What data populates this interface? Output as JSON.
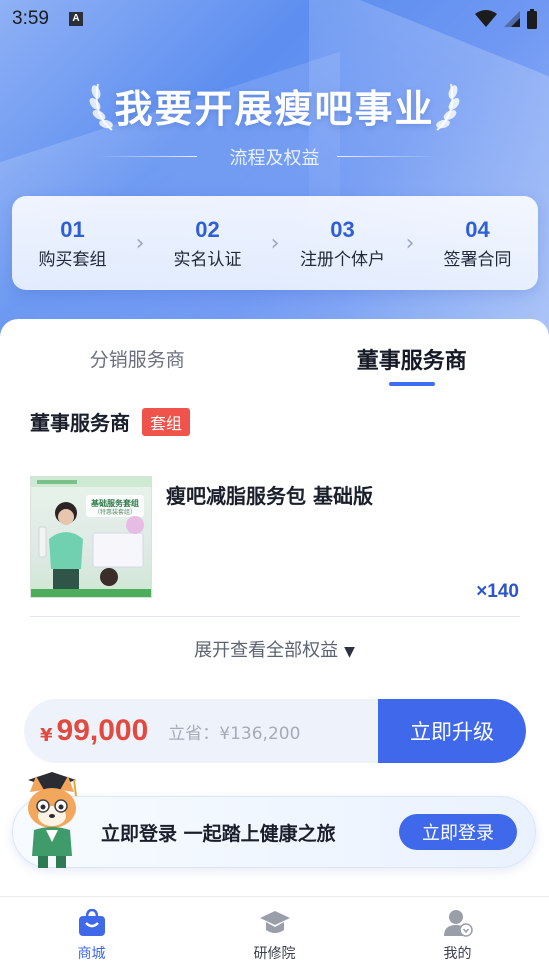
{
  "status_bar": {
    "time": "3:59",
    "notification_letter": "A"
  },
  "hero": {
    "title": "我要开展瘦吧事业",
    "subtitle": "流程及权益"
  },
  "steps": [
    {
      "num": "01",
      "label": "购买套组"
    },
    {
      "num": "02",
      "label": "实名认证"
    },
    {
      "num": "03",
      "label": "注册个体户"
    },
    {
      "num": "04",
      "label": "签署合同"
    }
  ],
  "tabs": [
    {
      "label": "分销服务商",
      "active": false
    },
    {
      "label": "董事服务商",
      "active": true
    }
  ],
  "card": {
    "title": "董事服务商",
    "badge": "套组",
    "product": {
      "name": "瘦吧减脂服务包 基础版",
      "quantity": "×140",
      "image_caption": "基础服务套组",
      "image_caption_sub": "（特惠装套组）"
    },
    "expand_label": "展开查看全部权益"
  },
  "buy_bar": {
    "currency": "¥",
    "price": "99,000",
    "save_text": "立省：¥136,200",
    "upgrade_label": "立即升级"
  },
  "login_banner": {
    "text": "立即登录 一起踏上健康之旅",
    "button": "立即登录"
  },
  "bottom_nav": [
    {
      "label": "商城",
      "icon": "shopping-bag-icon",
      "active": true
    },
    {
      "label": "研修院",
      "icon": "graduation-cap-icon",
      "active": false
    },
    {
      "label": "我的",
      "icon": "user-icon",
      "active": false
    }
  ],
  "colors": {
    "accent": "#3f68ea",
    "price_red": "#e24a3f",
    "badge_red": "#f0534b",
    "hero_blue": "#5d8ef0"
  }
}
